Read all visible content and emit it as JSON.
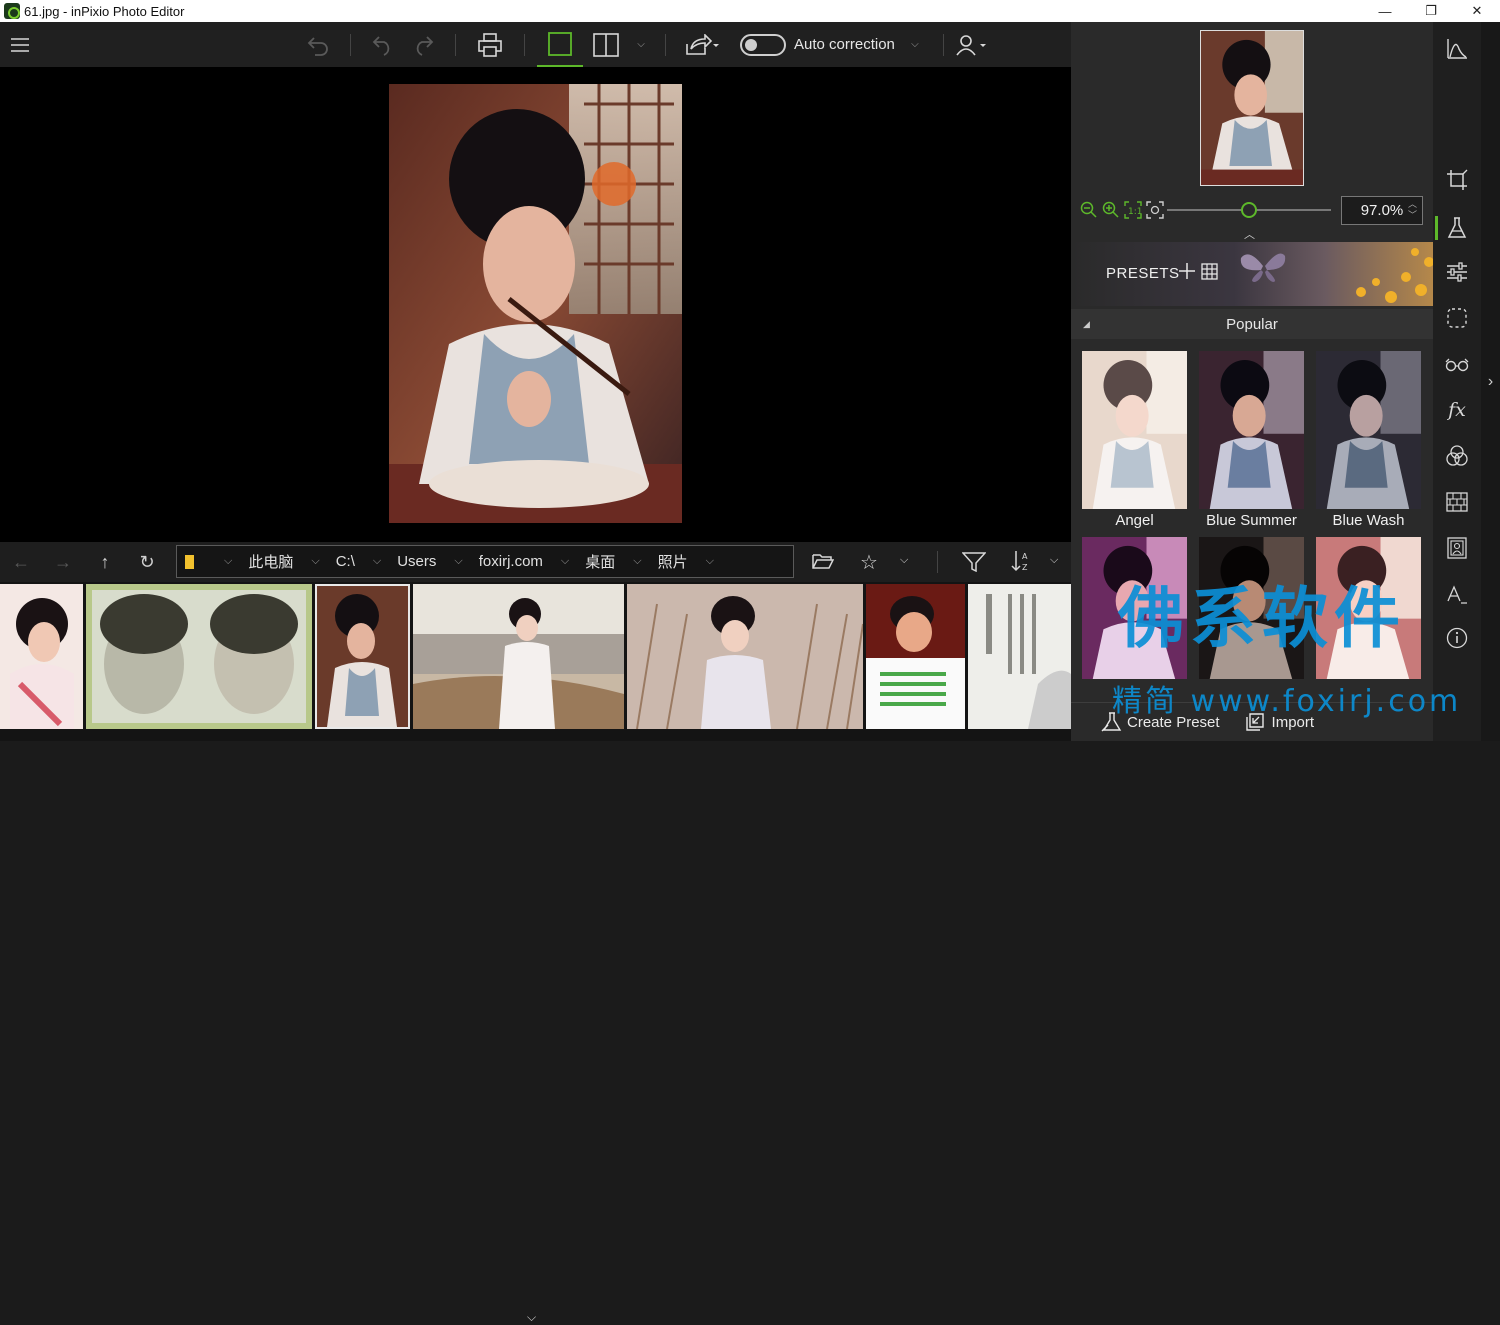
{
  "window": {
    "title": "61.jpg - inPixio Photo Editor",
    "minimize": "—",
    "maximize": "❐",
    "close": "✕"
  },
  "toolbar": {
    "auto_correction_label": "Auto correction",
    "auto_correction_on": false
  },
  "navigator": {
    "breadcrumbs": [
      "此电脑",
      "C:\\",
      "Users",
      "foxirj.com",
      "桌面",
      "照片"
    ]
  },
  "right_panel": {
    "zoom_value": "97.0%",
    "zoom_level": 0.5,
    "presets_title": "PRESETS",
    "group_title": "Popular",
    "presets": [
      {
        "label": "Angel"
      },
      {
        "label": "Blue Summer"
      },
      {
        "label": "Blue Wash"
      },
      {
        "label": ""
      },
      {
        "label": ""
      },
      {
        "label": ""
      }
    ],
    "create_preset_label": "Create Preset",
    "import_label": "Import"
  },
  "watermark": {
    "main": "佛系软件",
    "sub": "精简 www.foxirj.com"
  },
  "colors": {
    "accent": "#5db82a",
    "watermark": "#0b8fd6"
  }
}
